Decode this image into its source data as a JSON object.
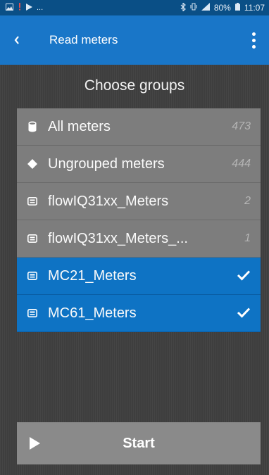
{
  "status_bar": {
    "left_icons": [
      "image-icon",
      "signal-alert-icon",
      "play-store-icon"
    ],
    "more": "...",
    "battery": "80%",
    "time": "11:07"
  },
  "app_bar": {
    "title": "Read meters"
  },
  "section": {
    "title": "Choose groups"
  },
  "groups": [
    {
      "label": "All meters",
      "count": "473",
      "icon": "cylinder-icon",
      "selected": false
    },
    {
      "label": "Ungrouped meters",
      "count": "444",
      "icon": "diamond-icon",
      "selected": false
    },
    {
      "label": "flowIQ31xx_Meters",
      "count": "2",
      "icon": "meter-icon",
      "selected": false
    },
    {
      "label": "flowIQ31xx_Meters_...",
      "count": "1",
      "icon": "meter-icon",
      "selected": false
    },
    {
      "label": "MC21_Meters",
      "count": "",
      "icon": "meter-icon",
      "selected": true
    },
    {
      "label": "MC61_Meters",
      "count": "",
      "icon": "meter-icon",
      "selected": true
    }
  ],
  "start_button": {
    "label": "Start"
  },
  "colors": {
    "status_bar": "#0a4f86",
    "app_bar": "#1976c8",
    "selected_row": "#0e73c4",
    "row": "#7d7d7d",
    "background": "#3e3e3e"
  }
}
